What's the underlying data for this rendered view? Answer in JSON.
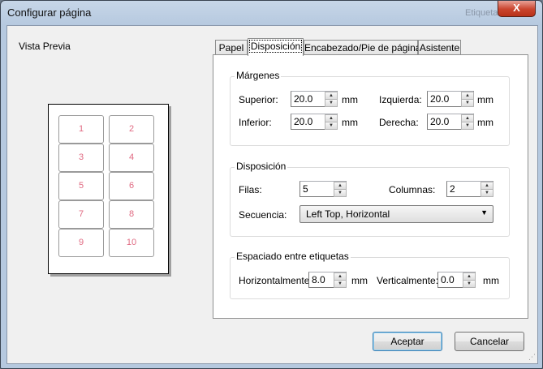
{
  "window": {
    "title": "Configurar página",
    "ghost_title": "Etiquetas",
    "close_label": "X"
  },
  "preview": {
    "label": "Vista Previa",
    "cells": [
      "1",
      "2",
      "3",
      "4",
      "5",
      "6",
      "7",
      "8",
      "9",
      "10"
    ]
  },
  "tabs": [
    "Papel",
    "Disposición",
    "Encabezado/Pie de página",
    "Asistente"
  ],
  "active_tab": 1,
  "margins": {
    "title": "Márgenes",
    "unit": "mm",
    "superior": {
      "label": "Superior:",
      "value": "20.0"
    },
    "inferior": {
      "label": "Inferior:",
      "value": "20.0"
    },
    "izquierda": {
      "label": "Izquierda:",
      "value": "20.0"
    },
    "derecha": {
      "label": "Derecha:",
      "value": "20.0"
    }
  },
  "layout": {
    "title": "Disposición",
    "filas": {
      "label": "Filas:",
      "value": "5"
    },
    "columnas": {
      "label": "Columnas:",
      "value": "2"
    },
    "secuencia": {
      "label": "Secuencia:",
      "value": "Left Top, Horizontal"
    }
  },
  "spacing": {
    "title": "Espaciado entre etiquetas",
    "unit": "mm",
    "horizontal": {
      "label": "Horizontalmente:",
      "value": "8.0"
    },
    "vertical": {
      "label": "Verticalmente:",
      "value": "0.0"
    }
  },
  "buttons": {
    "ok": "Aceptar",
    "cancel": "Cancelar"
  },
  "icons": {
    "spin_up": "▲",
    "spin_down": "▼",
    "dropdown": "▼",
    "grip": "⋰"
  }
}
